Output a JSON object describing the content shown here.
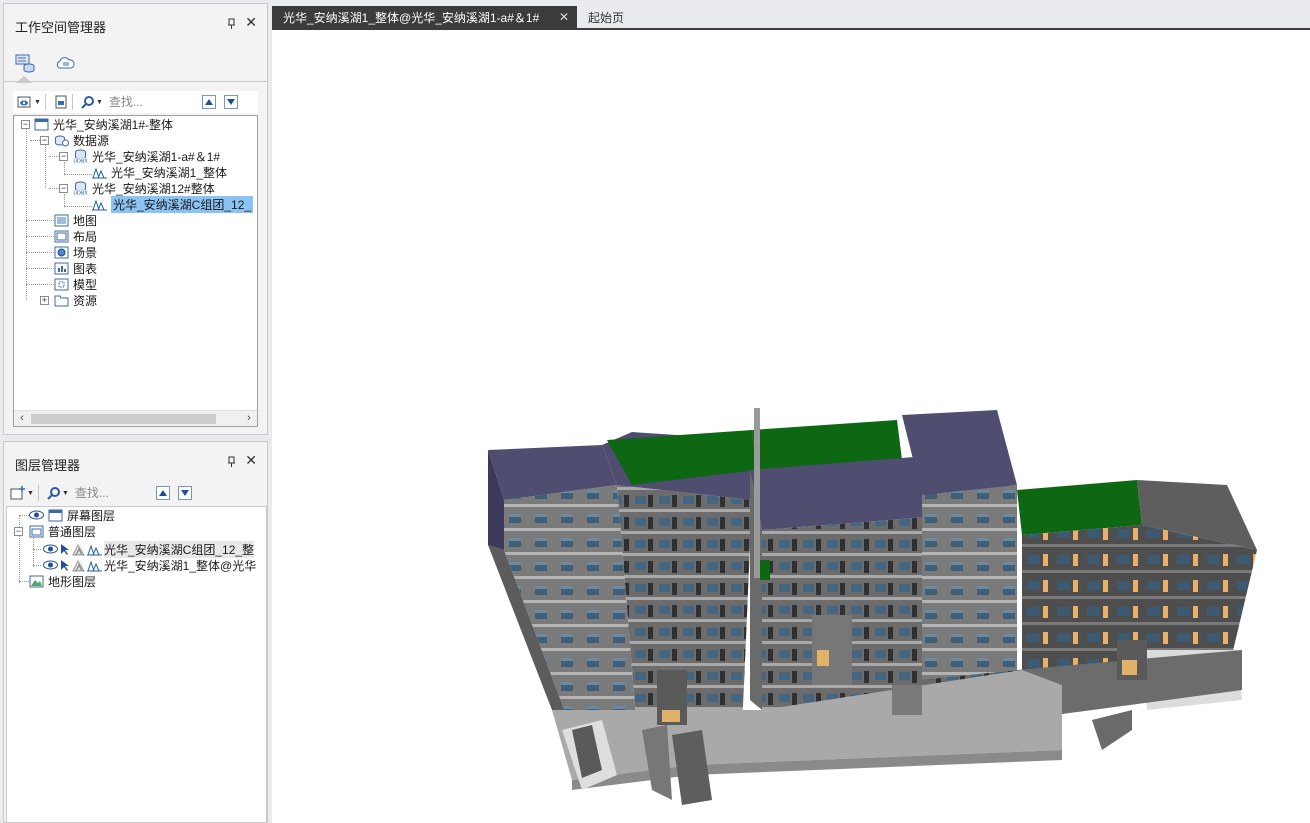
{
  "workspace_panel": {
    "title": "工作空间管理器",
    "close": "✕",
    "tabs": [
      "workspace-tree-icon",
      "cloud-icon"
    ],
    "search_placeholder": "查找...",
    "tree": {
      "root": "光华_安纳溪湖1#-整体",
      "datasources": "数据源",
      "ds1": "光华_安纳溪湖1-a#＆1#",
      "ds1_dataset": "光华_安纳溪湖1_整体",
      "ds2": "光华_安纳溪湖12#整体",
      "ds2_dataset": "光华_安纳溪湖C组团_12_",
      "maps": "地图",
      "layouts": "布局",
      "scenes": "场景",
      "charts": "图表",
      "models": "模型",
      "resources": "资源"
    }
  },
  "layer_panel": {
    "title": "图层管理器",
    "close": "✕",
    "search_placeholder": "查找...",
    "tree": {
      "screen_layers": "屏幕图层",
      "normal_layers": "普通图层",
      "layer1": "光华_安纳溪湖C组团_12_整",
      "layer2": "光华_安纳溪湖1_整体@光华",
      "terrain_layers": "地形图层"
    }
  },
  "document_tabs": {
    "active": "光华_安纳溪湖1_整体@光华_安纳溪湖1-a#＆1#",
    "active_close": "✕",
    "inactive": "起始页"
  },
  "colors": {
    "accent_tab": "#3c3c3c",
    "selection": "#8bc3f2",
    "roof_purple": "#4f4d70",
    "roof_green": "#0e6712"
  }
}
